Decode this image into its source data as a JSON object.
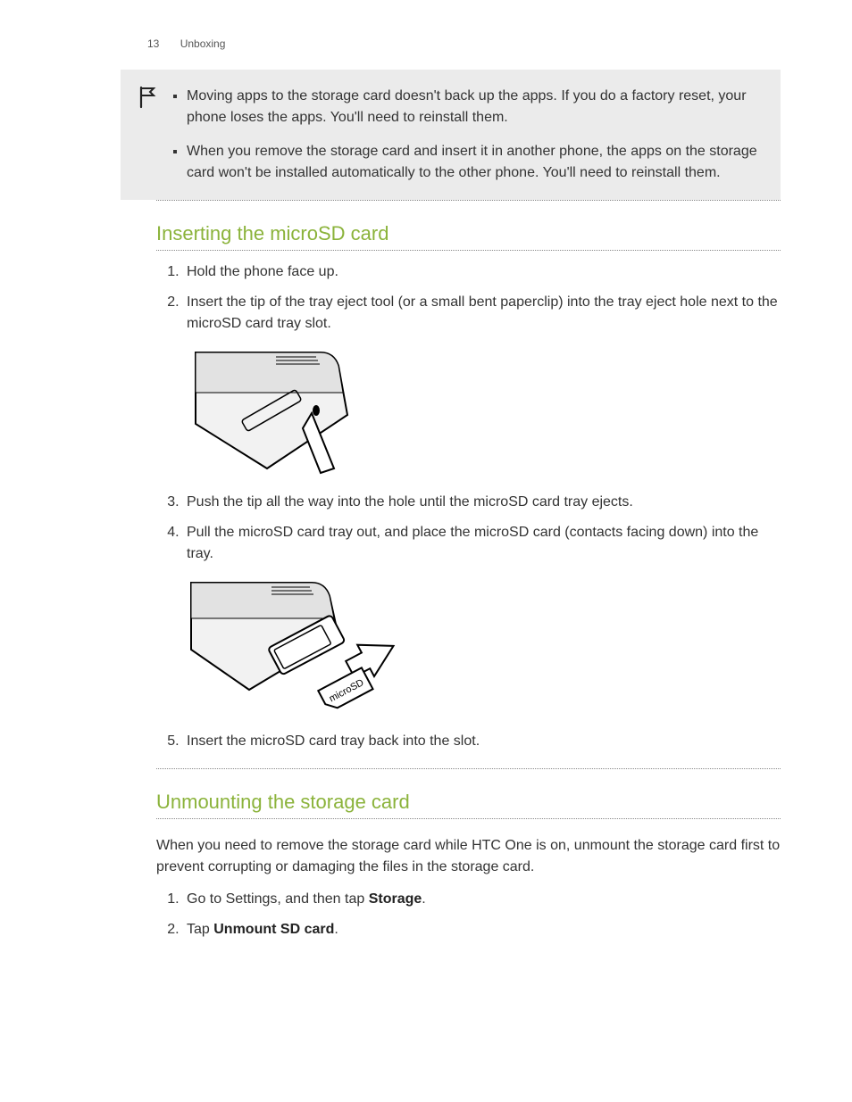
{
  "header": {
    "page_number": "13",
    "section": "Unboxing"
  },
  "note": {
    "items": [
      "Moving apps to the storage card doesn't back up the apps. If you do a factory reset, your phone loses the apps. You'll need to reinstall them.",
      "When you remove the storage card and insert it in another phone, the apps on the storage card won't be installed automatically to the other phone. You'll need to reinstall them."
    ]
  },
  "insert_section": {
    "title": "Inserting the microSD card",
    "steps": {
      "s1": "Hold the phone face up.",
      "s2": "Insert the tip of the tray eject tool (or a small bent paperclip) into the tray eject hole next to the microSD card tray slot.",
      "s3": "Push the tip all the way into the hole until the microSD card tray ejects.",
      "s4": "Pull the microSD card tray out, and place the microSD card (contacts facing down) into the tray.",
      "s5": "Insert the microSD card tray back into the slot."
    },
    "illus2_label": "microSD"
  },
  "unmount_section": {
    "title": "Unmounting the storage card",
    "intro": "When you need to remove the storage card while HTC One is on, unmount the storage card first to prevent corrupting or damaging the files in the storage card.",
    "steps": {
      "s1_pre": "Go to Settings, and then tap ",
      "s1_bold": "Storage",
      "s1_post": ".",
      "s2_pre": "Tap ",
      "s2_bold": "Unmount SD card",
      "s2_post": "."
    }
  }
}
